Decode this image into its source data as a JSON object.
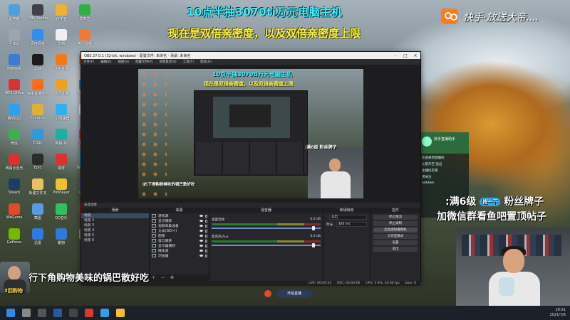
{
  "overlay": {
    "title_line1": "10点半抽3070ti万元电脑主机",
    "title_line2": "现在是双倍亲密度，以及双倍亲密度上限",
    "platform_text": "快手·放送大帝....",
    "fan_line1_prefix": ":满6级",
    "fan_line1_badge": "按一下",
    "fan_line1_suffix": "粉丝牌子",
    "fan_line2": "加微信群看鱼吧置顶帖子",
    "bottom_caption": "行下角购物美味的锅巴散好吃",
    "mini_cam_label": "3回购物"
  },
  "obs": {
    "window_title": "OBS 27.0.1 (32-bit, windows) - 配置文件: 未命名 - 场景: 未命名",
    "menu": [
      "文件(F)",
      "编辑(E)",
      "视图(V)",
      "配置文件(P)",
      "场景集合(S)",
      "工具(T)",
      "帮助(H)"
    ],
    "preview": {
      "t1": "10点半抽3070ti万元电脑主机",
      "t2": "现在是双倍亲密度，以及双倍亲密度上限",
      "fan": ":满6级 粉丝牌子",
      "caption": "右下角购物美味的锅巴散好吃"
    },
    "scene_bar_label": "未选场景",
    "docks": {
      "scenes": {
        "title": "场景",
        "items": [
          "场景",
          "场景 2",
          "场景 3",
          "场景 4",
          "场景 5",
          "场景 6"
        ]
      },
      "sources": {
        "title": "来源",
        "items": [
          "游戏源",
          "显示捕获",
          "视频采集设备",
          "文本(GDI+)",
          "图像",
          "窗口捕获",
          "显示器捕获",
          "媒体源",
          "浏览器"
        ]
      },
      "mixer": {
        "title": "混音器",
        "channels": [
          {
            "name": "桌面音频",
            "level": "0.0 dB"
          },
          {
            "name": "麦克风/Aux",
            "level": "0.0 dB"
          }
        ]
      },
      "transitions": {
        "title": "转场特效",
        "type_label": "淡出",
        "duration_label": "时长",
        "duration_value": "300 ms"
      },
      "controls": {
        "title": "控件",
        "buttons": [
          "停止推流",
          "停止录制",
          "启动虚拟摄像机",
          "工作室模式",
          "设置",
          "退出"
        ]
      }
    },
    "status": {
      "live": "LIVE: 00:00:54",
      "rec": "REC: 00:00:00",
      "cpu": "CPU: 5.9%, 30.00 fps",
      "kbps": "kb/s: 0"
    }
  },
  "chat": {
    "name": "快手直播助手",
    "lines": [
      "欢迎来到直播间",
      "火箭升空 送出",
      "主播好厉害",
      "求关注",
      "666666"
    ]
  },
  "control_strip": {
    "pill_label": "开始直播"
  },
  "desktop_icons": [
    {
      "label": "此电脑",
      "color": "#4aa0e0"
    },
    {
      "label": "回收站",
      "color": "#9aa6b2"
    },
    {
      "label": "控制面板",
      "color": "#3c7ad8"
    },
    {
      "label": "WPS Office",
      "color": "#d8332e"
    },
    {
      "label": "腾讯QQ",
      "color": "#2ea0f0"
    },
    {
      "label": "微信",
      "color": "#3cb04a"
    },
    {
      "label": "网易云音乐",
      "color": "#d8332e"
    },
    {
      "label": "Steam",
      "color": "#1e3c6a"
    },
    {
      "label": "WeGame",
      "color": "#e04b2a"
    },
    {
      "label": "GeForce",
      "color": "#76b900"
    },
    {
      "label": "OBS Studio",
      "color": "#404048"
    },
    {
      "label": "百度网盘",
      "color": "#2f8ff0"
    },
    {
      "label": "剪映",
      "color": "#1b1b1b"
    },
    {
      "label": "快手直播伴侣",
      "color": "#ff6a1a"
    },
    {
      "label": "Chrome",
      "color": "#e0b030"
    },
    {
      "label": "Edge",
      "color": "#2f9ad8"
    },
    {
      "label": "Epic",
      "color": "#2b2b2b"
    },
    {
      "label": "新建文件夹",
      "color": "#e8c160"
    },
    {
      "label": "截图",
      "color": "#5a9ae0"
    },
    {
      "label": "迅雷",
      "color": "#2f7ae0"
    },
    {
      "label": "YY语音",
      "color": "#f0b030"
    },
    {
      "label": "文档",
      "color": "#f0f0f0"
    },
    {
      "label": "斗鱼直播",
      "color": "#f07a1a"
    },
    {
      "label": "虎牙直播",
      "color": "#f0a01a"
    },
    {
      "label": "UU加速器",
      "color": "#2fb0f0"
    },
    {
      "label": "网易UU",
      "color": "#1bb0a0"
    },
    {
      "label": "录屏",
      "color": "#d8332e"
    },
    {
      "label": "PotPlayer",
      "color": "#f0c030"
    },
    {
      "label": "QQ音乐",
      "color": "#30c060"
    },
    {
      "label": "酷狗",
      "color": "#2f7ad8"
    },
    {
      "label": "爱奇艺",
      "color": "#30b040"
    },
    {
      "label": "腾讯视频",
      "color": "#f07a30"
    },
    {
      "label": "Origin",
      "color": "#f06a1a"
    },
    {
      "label": "暴雪战网",
      "color": "#2f8ae0"
    },
    {
      "label": "雷神",
      "color": "#e8e8e8"
    },
    {
      "label": "鲁大师",
      "color": "#e0401a"
    },
    {
      "label": "Telegram",
      "color": "#2aa0e0"
    },
    {
      "label": "CPU-Z",
      "color": "#5a4ab0"
    },
    {
      "label": "MSI",
      "color": "#d82020"
    },
    {
      "label": "音频",
      "color": "#8a8a8a"
    }
  ],
  "taskbar": {
    "icons": [
      "#2f8ae0",
      "#888",
      "#555",
      "#2b5a9a",
      "#444",
      "#d83b2a",
      "#2fa0e0",
      "#f0c030"
    ],
    "time": "20:51",
    "date": "2021/7/6"
  }
}
